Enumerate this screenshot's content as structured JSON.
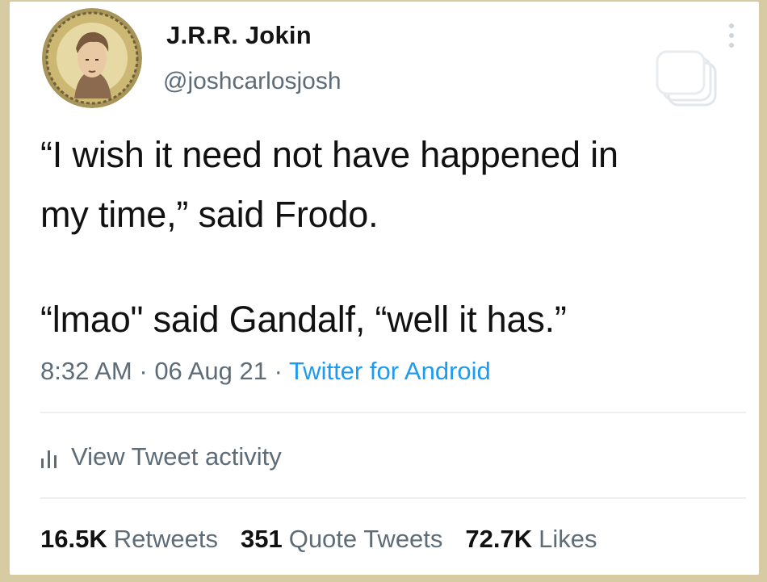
{
  "author": {
    "name": "J.R.R. Jokin",
    "handle": "@joshcarlosjosh"
  },
  "tweet": {
    "lines": [
      "“I wish it need not have happened in",
      "my time,” said Frodo.",
      "“lmao\" said Gandalf, “well it has.”"
    ],
    "time": "8:32 AM",
    "date": "06 Aug 21",
    "separator": " · ",
    "source": "Twitter for Android"
  },
  "activity": {
    "label": "View Tweet activity",
    "icon": "bar-chart-icon"
  },
  "stats": {
    "retweets_count": "16.5K",
    "retweets_label": "Retweets",
    "quotes_count": "351",
    "quotes_label": "Quote Tweets",
    "likes_count": "72.7K",
    "likes_label": "Likes"
  },
  "colors": {
    "frame": "#d6cba3",
    "text": "#111111",
    "muted": "#5e6c78",
    "link": "#1d9bf0",
    "divider": "#eceff2"
  },
  "icons": {
    "more": "more-vertical-icon",
    "copy": "copy-overlay-icon",
    "avatar": "avatar-portrait"
  }
}
